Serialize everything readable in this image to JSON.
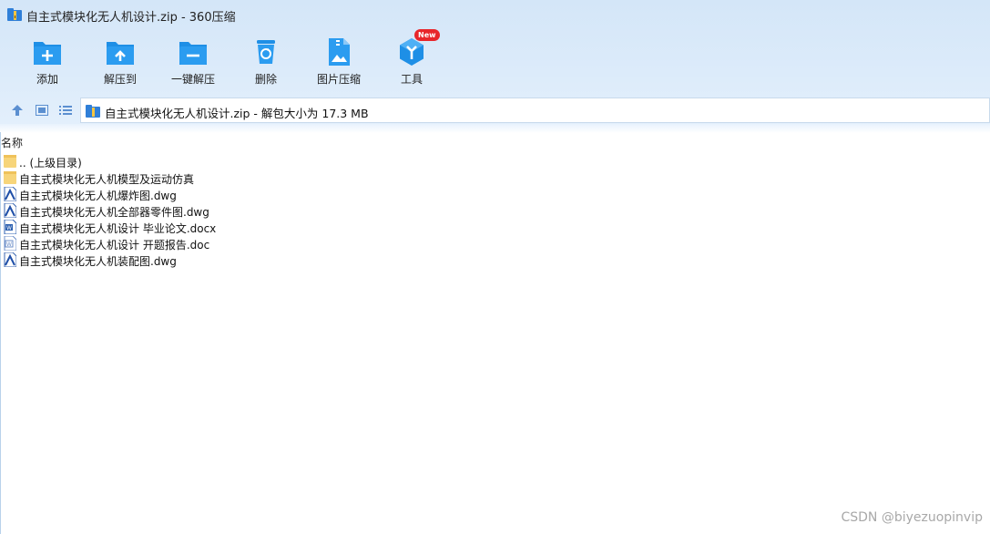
{
  "window": {
    "title": "自主式模块化无人机设计.zip - 360压缩"
  },
  "toolbar": {
    "add": "添加",
    "extract_to": "解压到",
    "one_click_extract": "一键解压",
    "delete": "删除",
    "image_compress": "图片压缩",
    "tools": "工具",
    "tools_badge": "New"
  },
  "address": {
    "text": "自主式模块化无人机设计.zip - 解包大小为 17.3 MB"
  },
  "list": {
    "column_name": "名称",
    "items": [
      {
        "name": ".. (上级目录)",
        "icon": "folder-icon"
      },
      {
        "name": "自主式模块化无人机模型及运动仿真",
        "icon": "folder-icon"
      },
      {
        "name": "自主式模块化无人机爆炸图.dwg",
        "icon": "dwg-file-icon"
      },
      {
        "name": "自主式模块化无人机全部器零件图.dwg",
        "icon": "dwg-file-icon"
      },
      {
        "name": "自主式模块化无人机设计 毕业论文.docx",
        "icon": "docx-file-icon"
      },
      {
        "name": "自主式模块化无人机设计 开题报告.doc",
        "icon": "doc-file-icon"
      },
      {
        "name": "自主式模块化无人机装配图.dwg",
        "icon": "dwg-file-icon"
      }
    ]
  },
  "watermark": "CSDN @biyezuopinvip",
  "colors": {
    "accent": "#1e8fe6",
    "badge": "#e8262b",
    "folder": "#f7d57a"
  }
}
